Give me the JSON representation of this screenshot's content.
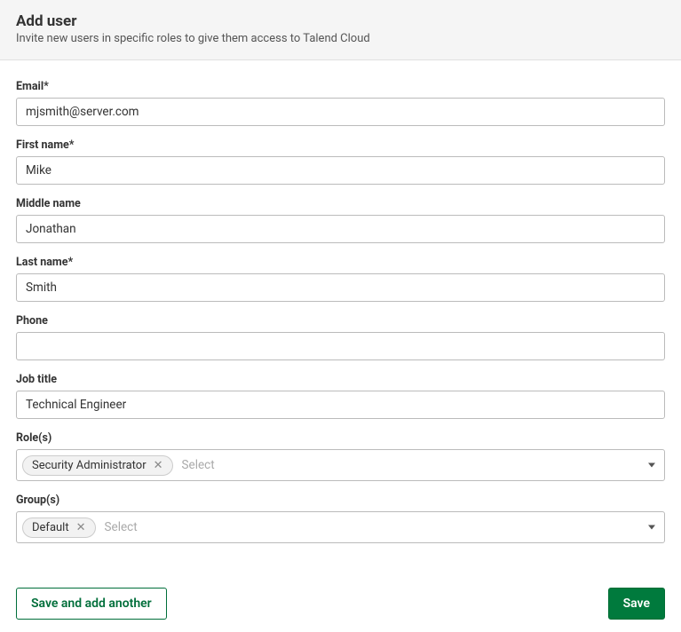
{
  "header": {
    "title": "Add user",
    "subtitle": "Invite new users in specific roles to give them access to Talend Cloud"
  },
  "fields": {
    "email": {
      "label": "Email*",
      "value": "mjsmith@server.com"
    },
    "firstName": {
      "label": "First name*",
      "value": "Mike"
    },
    "middleName": {
      "label": "Middle name",
      "value": "Jonathan"
    },
    "lastName": {
      "label": "Last name*",
      "value": "Smith"
    },
    "phone": {
      "label": "Phone",
      "value": ""
    },
    "jobTitle": {
      "label": "Job title",
      "value": "Technical Engineer"
    },
    "roles": {
      "label": "Role(s)",
      "chips": [
        "Security Administrator"
      ],
      "placeholder": "Select"
    },
    "groups": {
      "label": "Group(s)",
      "chips": [
        "Default"
      ],
      "placeholder": "Select"
    }
  },
  "actions": {
    "saveAndAddAnother": "Save and add another",
    "save": "Save"
  }
}
